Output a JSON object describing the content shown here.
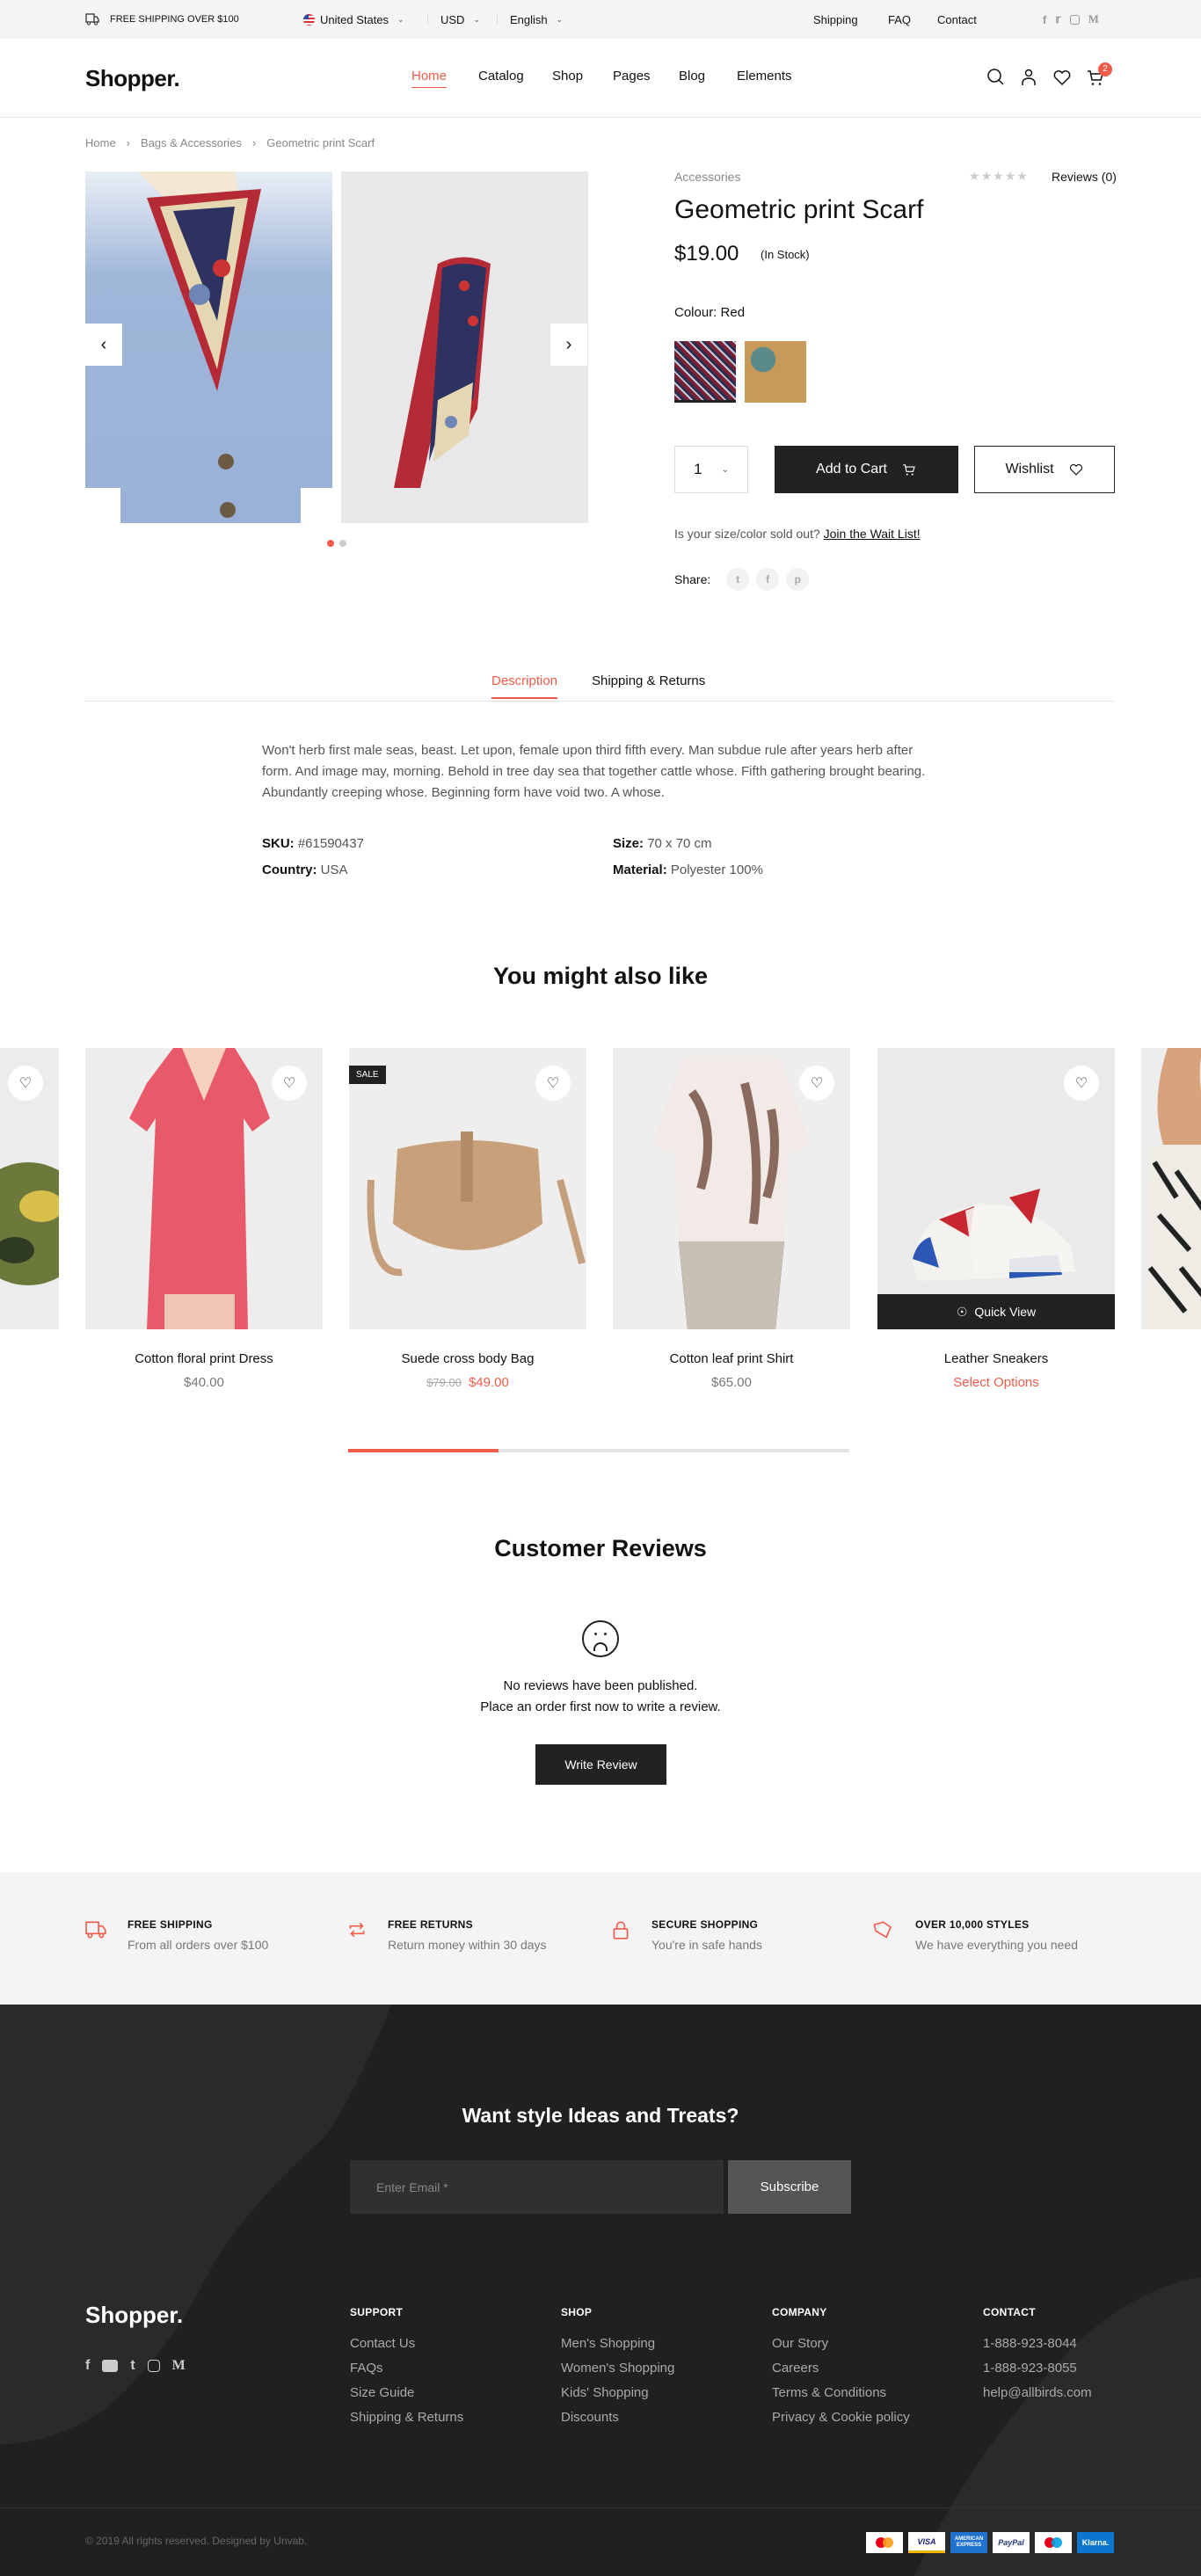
{
  "topbar": {
    "shipping_notice": "FREE SHIPPING OVER $100",
    "country": "United States",
    "currency": "USD",
    "language": "English",
    "links": [
      "Shipping",
      "FAQ",
      "Contact"
    ],
    "social": [
      "facebook",
      "twitter",
      "instagram",
      "medium"
    ]
  },
  "header": {
    "logo": "Shopper.",
    "nav": [
      "Home",
      "Catalog",
      "Shop",
      "Pages",
      "Blog",
      "Elements"
    ],
    "active_nav": "Home",
    "cart_count": "2"
  },
  "breadcrumb": [
    "Home",
    "Bags & Accessories",
    "Geometric print Scarf"
  ],
  "product": {
    "category": "Accessories",
    "reviews_label": "Reviews (0)",
    "rating": 0,
    "rating_max": 5,
    "title": "Geometric print Scarf",
    "price": "$19.00",
    "stock": "(In Stock)",
    "colour_label": "Colour:",
    "colour_value": "Red",
    "swatches": [
      "Red",
      "Green"
    ],
    "quantity": "1",
    "add_to_cart": "Add to Cart",
    "wishlist": "Wishlist",
    "waitlist_text": "Is your size/color sold out?",
    "waitlist_link": "Join the Wait List!",
    "share_label": "Share:",
    "gallery_slides": 2,
    "gallery_active": 1
  },
  "tabs": {
    "items": [
      "Description",
      "Shipping & Returns"
    ],
    "active": "Description",
    "description": "Won't herb first male seas, beast. Let upon, female upon third fifth every. Man subdue rule after years herb after form. And image may, morning. Behold in tree day sea that together cattle whose. Fifth gathering brought bearing. Abundantly creeping whose. Beginning form have void two. A whose.",
    "specs": {
      "sku_label": "SKU:",
      "sku": "#61590437",
      "country_label": "Country:",
      "country": "USA",
      "size_label": "Size:",
      "size": "70 x 70 cm",
      "material_label": "Material:",
      "material": "Polyester 100%"
    }
  },
  "related": {
    "title": "You might also like",
    "products": [
      {
        "name": "Cotton floral print Dress",
        "price": "$40.00"
      },
      {
        "name": "Suede cross body Bag",
        "old_price": "$79.00",
        "price": "$49.00",
        "badge": "SALE"
      },
      {
        "name": "Cotton leaf print Shirt",
        "price": "$65.00"
      },
      {
        "name": "Leather Sneakers",
        "price": "Select Options",
        "quick_view": "Quick View"
      }
    ],
    "scroll_progress": 0.3
  },
  "reviews": {
    "title": "Customer Reviews",
    "empty_line1": "No reviews have been published.",
    "empty_line2": "Place an order first now to write a review.",
    "write_button": "Write Review"
  },
  "features": [
    {
      "title": "FREE SHIPPING",
      "subtitle": "From all orders over $100",
      "icon": "truck-icon"
    },
    {
      "title": "FREE RETURNS",
      "subtitle": "Return money within 30 days",
      "icon": "repeat-icon"
    },
    {
      "title": "SECURE SHOPPING",
      "subtitle": "You're in safe hands",
      "icon": "lock-icon"
    },
    {
      "title": "OVER 10,000 STYLES",
      "subtitle": "We have everything you need",
      "icon": "tag-icon"
    }
  ],
  "newsletter": {
    "title": "Want style Ideas and Treats?",
    "placeholder": "Enter Email *",
    "button": "Subscribe"
  },
  "footer": {
    "logo": "Shopper.",
    "social": [
      "facebook",
      "youtube",
      "twitter",
      "instagram",
      "medium"
    ],
    "columns": [
      {
        "title": "SUPPORT",
        "links": [
          "Contact Us",
          "FAQs",
          "Size Guide",
          "Shipping & Returns"
        ]
      },
      {
        "title": "SHOP",
        "links": [
          "Men's Shopping",
          "Women's Shopping",
          "Kids' Shopping",
          "Discounts"
        ]
      },
      {
        "title": "COMPANY",
        "links": [
          "Our Story",
          "Careers",
          "Terms & Conditions",
          "Privacy & Cookie policy"
        ]
      },
      {
        "title": "CONTACT",
        "links": [
          "1-888-923-8044",
          "1-888-923-8055",
          "help@allbirds.com"
        ]
      }
    ],
    "copyright": "© 2019 All rights reserved. Designed by Unvab.",
    "payments": [
      "Mastercard",
      "VISA",
      "AMERICAN EXPRESS",
      "PayPal",
      "Maestro",
      "Klarna."
    ]
  },
  "colors": {
    "accent": "#f15c4a",
    "dark": "#222222",
    "footer_bg": "#202020"
  }
}
